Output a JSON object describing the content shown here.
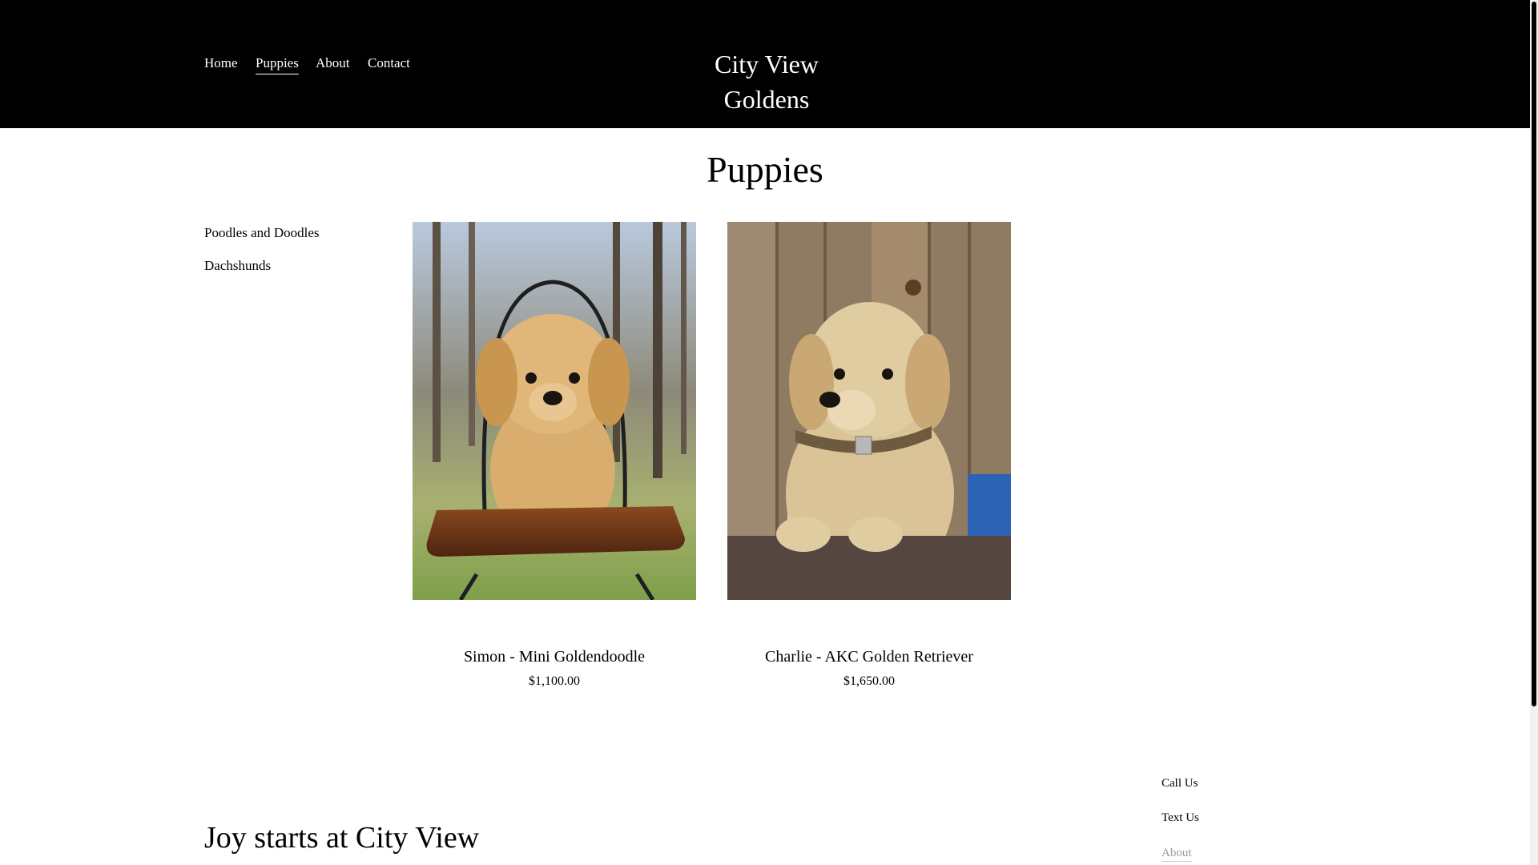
{
  "nav": {
    "items": [
      {
        "label": "Home"
      },
      {
        "label": "Puppies"
      },
      {
        "label": "About"
      },
      {
        "label": "Contact"
      }
    ],
    "active": "Puppies"
  },
  "brand": {
    "title": "City View Goldens"
  },
  "page": {
    "title": "Puppies"
  },
  "sidebar": {
    "categories": [
      {
        "label": "Poodles and Doodles"
      },
      {
        "label": "Dachshunds"
      }
    ]
  },
  "products": [
    {
      "name": "Simon - Mini Goldendoodle",
      "price": "$1,100.00",
      "image": "puppy-on-chair-photo"
    },
    {
      "name": "Charlie - AKC Golden Retriever",
      "price": "$1,650.00",
      "image": "puppy-in-box-photo"
    }
  ],
  "footer": {
    "tagline": "Joy starts at City View",
    "links": [
      {
        "label": "Call Us"
      },
      {
        "label": "Text Us"
      },
      {
        "label": "About"
      }
    ]
  },
  "colors": {
    "header_bg": "#000000",
    "page_bg": "#ffffff",
    "text": "#000000"
  }
}
